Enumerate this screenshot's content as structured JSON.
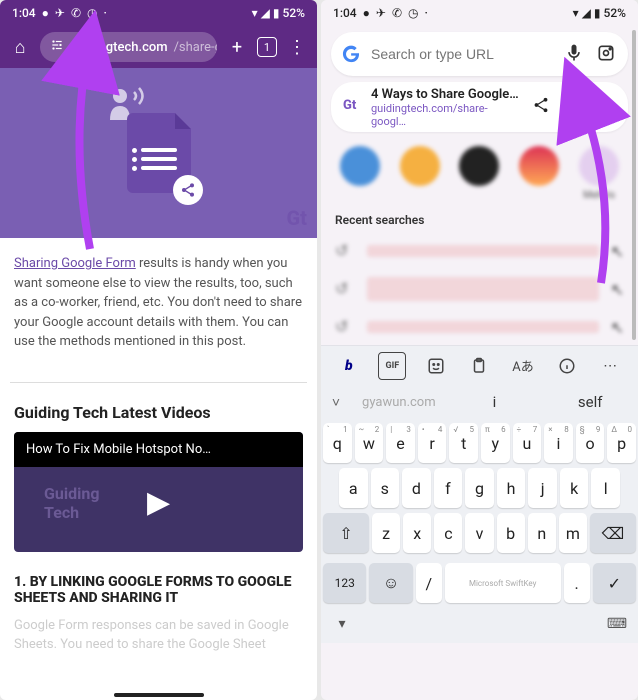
{
  "status": {
    "time": "1:04",
    "battery": "52%"
  },
  "left": {
    "url_domain": "guidingtech.com",
    "url_path": "/share-g",
    "tab_count": "1",
    "article_link": "Sharing Google Form",
    "article_rest": " results is handy when you want someone else to view the results, too, such as a co-worker, friend, etc. You don't need to share your Google account details with them. You can use the methods mentioned in this post.",
    "latest_videos": "Guiding Tech Latest Videos",
    "video_title": "How To Fix Mobile Hotspot No…",
    "heading1": "1. BY LINKING GOOGLE FORMS TO GOOGLE SHEETS AND SHARING IT",
    "faded": "Google Form responses can be saved in Google Sheets. You need to share the Google Sheet"
  },
  "right": {
    "search_placeholder": "Search or type URL",
    "sugg_title": "4 Ways to Share Google F…",
    "sugg_url": "guidingtech.com/share-googl…",
    "shortcut5": "Mehvis",
    "recent_label": "Recent searches",
    "kb_suggest": {
      "w1": "gyawun.com",
      "w2": "i",
      "w3": "self"
    },
    "ms_label": "Microsoft SwiftKey",
    "keys": {
      "row1": [
        "q",
        "w",
        "e",
        "r",
        "t",
        "y",
        "u",
        "i",
        "o",
        "p"
      ],
      "nums1": [
        "1",
        "2",
        "3",
        "4",
        "5",
        "6",
        "7",
        "8",
        "9",
        "0"
      ],
      "syms1": [
        "`",
        "~",
        "|",
        "•",
        "√",
        "π",
        "÷",
        "×",
        "§",
        "∆"
      ],
      "row2": [
        "a",
        "s",
        "d",
        "f",
        "g",
        "h",
        "j",
        "k",
        "l"
      ],
      "row3": [
        "z",
        "x",
        "c",
        "v",
        "b",
        "n",
        "m"
      ],
      "n123": "123",
      "slash": "/",
      "period": "."
    }
  }
}
